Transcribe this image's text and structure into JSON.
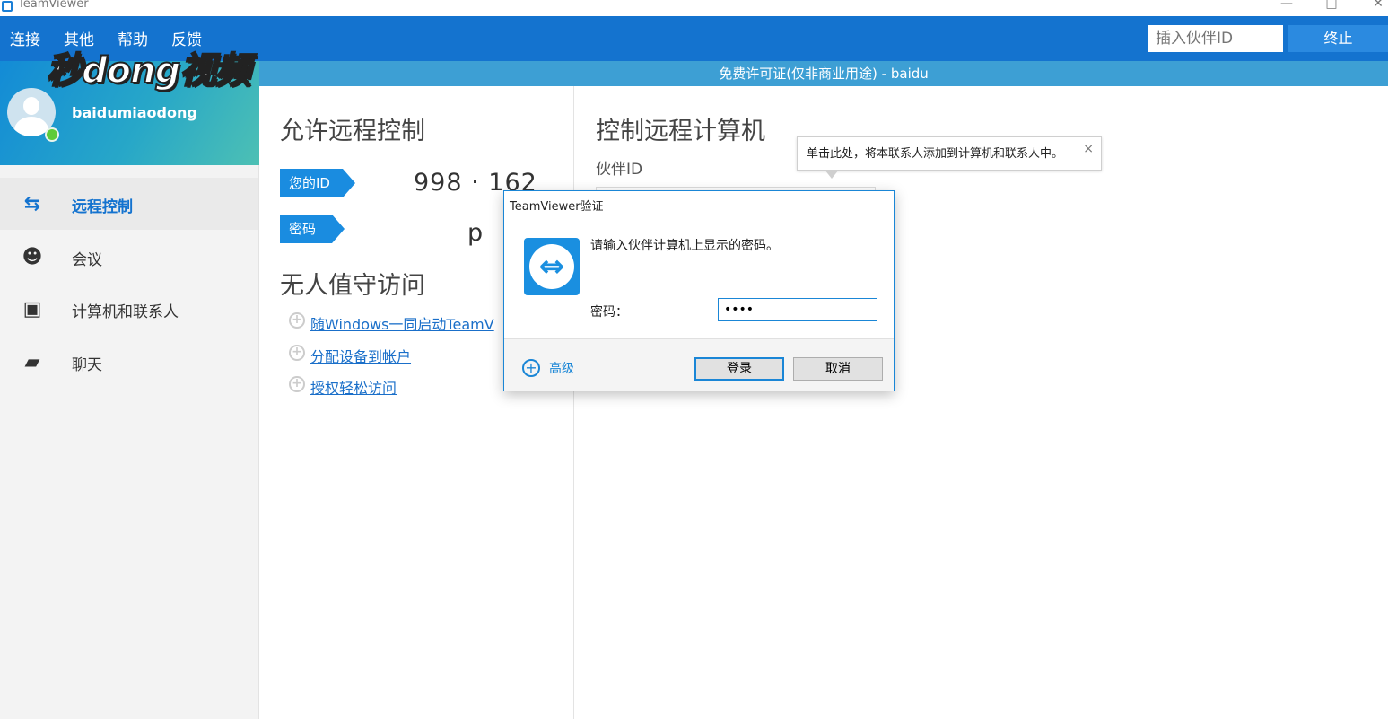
{
  "window": {
    "title": "TeamViewer",
    "controls": {
      "minimize": "—",
      "maximize": "□",
      "close": "✕"
    }
  },
  "topbar": {
    "menu": [
      "连接",
      "其他",
      "帮助",
      "反馈"
    ],
    "partner_input_placeholder": "插入伙伴ID",
    "end_button": "终止"
  },
  "watermark": "秒dong视频",
  "profile": {
    "username": "baidumiaodong"
  },
  "sidebar": {
    "items": [
      {
        "label": "远程控制",
        "icon": "arrows-icon",
        "active": true
      },
      {
        "label": "会议",
        "icon": "people-icon",
        "active": false
      },
      {
        "label": "计算机和联系人",
        "icon": "contacts-icon",
        "active": false
      },
      {
        "label": "聊天",
        "icon": "chat-icon",
        "active": false
      }
    ]
  },
  "license_bar": "免费许可证(仅非商业用途) - baidu",
  "allow_remote": {
    "title": "允许远程控制",
    "your_id_label": "您的ID",
    "your_id_value": "998 ‧ 162",
    "password_label": "密码",
    "password_value": "p"
  },
  "unattended": {
    "title": "无人值守访问",
    "links": [
      "随Windows一同启动TeamV",
      "分配设备到帐户",
      "授权轻松访问"
    ]
  },
  "control_remote": {
    "title": "控制远程计算机",
    "partner_id_label": "伙伴ID"
  },
  "tooltip": {
    "text": "单击此处，将本联系人添加到计算机和联系人中。",
    "close": "×"
  },
  "dialog": {
    "title": "TeamViewer验证",
    "message": "请输入伙伴计算机上显示的密码。",
    "password_label": "密码：",
    "password_value": "••••",
    "advanced": "高级",
    "login": "登录",
    "cancel": "取消"
  },
  "colors": {
    "brand_blue": "#1473cf",
    "license_bar": "#3d9fd4",
    "tag_blue": "#1a8ce0"
  }
}
